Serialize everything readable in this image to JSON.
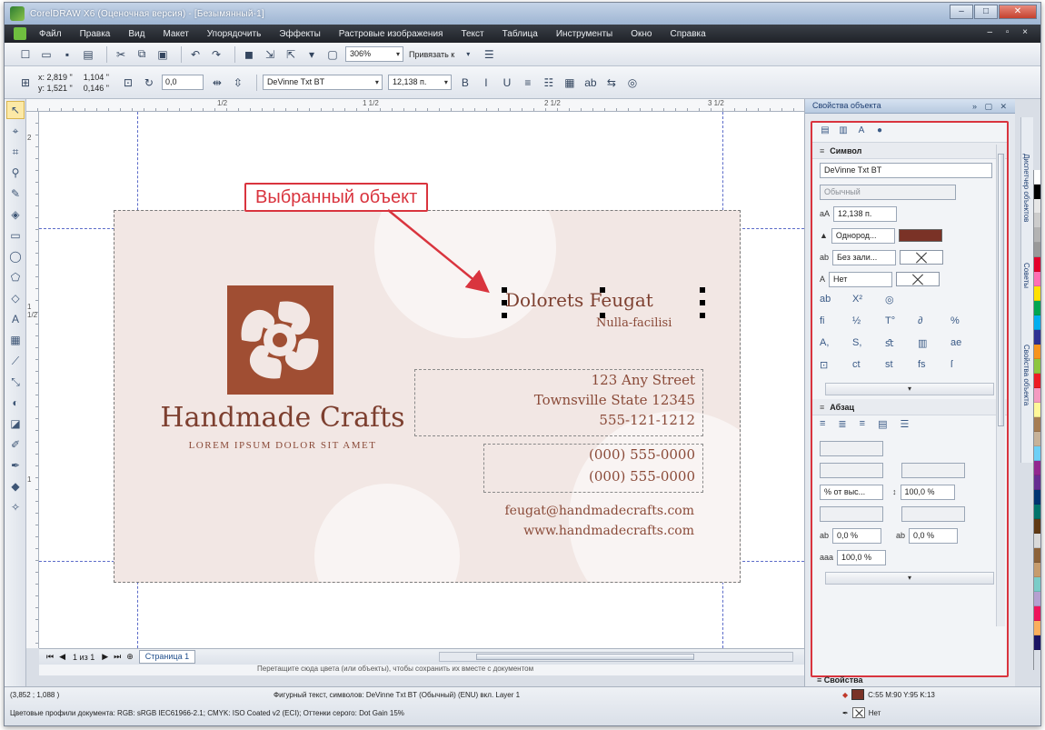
{
  "window": {
    "title": "CorelDRAW X6 (Оценочная версия) - [Безымянный-1]",
    "controls": [
      "–",
      "□",
      "✕"
    ]
  },
  "menu": {
    "items": [
      "Файл",
      "Правка",
      "Вид",
      "Макет",
      "Упорядочить",
      "Эффекты",
      "Растровые изображения",
      "Текст",
      "Таблица",
      "Инструменты",
      "Окно",
      "Справка"
    ],
    "right_controls": "– ▫ ×"
  },
  "toolbar1": {
    "zoom": "306%",
    "snap": "Привязать к"
  },
  "toolbar2": {
    "x": "x: 2,819 \"",
    "y": "y: 1,521 \"",
    "w": "1,104 \"",
    "h": "0,146 \"",
    "angle": "0,0",
    "font": "DeVinne Txt BT",
    "size": "12,138 п."
  },
  "rulers": {
    "h_ticks": [
      "1/2",
      "1 1/2",
      "2 1/2",
      "3 1/2"
    ],
    "v_ticks": [
      "2",
      "1 1/2",
      "1"
    ]
  },
  "card": {
    "company": "Handmade Crafts",
    "tagline": "LOREM IPSUM DOLOR SIT AMET",
    "person": "Dolorets Feugat",
    "person_sub": "Nulla-facilisi",
    "address1": "123 Any Street",
    "address2": "Townsville State 12345",
    "phone1": "555-121-1212",
    "phone2": "(000) 555-0000",
    "phone3": "(000) 555-0000",
    "email": "feugat@handmadecrafts.com",
    "web": "www.handmadecrafts.com",
    "logo_color": "#a04e33"
  },
  "callout": {
    "text": "Выбранный объект",
    "color": "#d9343e"
  },
  "pagebar": {
    "counter": "1 из 1",
    "page_tab": "Страница 1"
  },
  "hint": "Перетащите сюда цвета (или объекты), чтобы сохранить их вместе с документом",
  "dock": {
    "title": "Свойства объекта",
    "section_char": "Символ",
    "font": "DeVinne Txt BT",
    "style": "Обычный",
    "size": "12,138 п.",
    "fill_type": "Однород...",
    "fill_color": "#7a3226",
    "bg_fill": "Без зали...",
    "outline": "Нет",
    "section_para": "Абзац",
    "line_spacing_mode": "% от выс...",
    "line_spacing": "100,0 %",
    "char_spacing": "0,0 %",
    "word_spacing": "0,0 %",
    "lang_spacing": "100,0 %",
    "section_frame": "Свойства",
    "vtabs": [
      "Свойства объекта",
      "Диспетчер объектов",
      "Советы"
    ]
  },
  "palette": [
    "#ffffff",
    "#000000",
    "#e6e6e6",
    "#cccccc",
    "#b3b3b3",
    "#999999",
    "#e4002b",
    "#ff6fb4",
    "#ffe100",
    "#00a651",
    "#00aeef",
    "#2e3192",
    "#f7941d",
    "#8dc63f",
    "#ed1c24",
    "#f49ac1",
    "#fff799",
    "#a67c52",
    "#c7b299",
    "#6dcff6",
    "#92278f",
    "#662d91",
    "#003471",
    "#00746b",
    "#603913",
    "#d9d9d9",
    "#8c6239",
    "#c69c6d",
    "#7accc8",
    "#b5a0d0",
    "#ee145b",
    "#fbaf5d",
    "#1b1464"
  ],
  "status": {
    "coords": "(3,852 ; 1,088 )",
    "object": "Фигурный текст, символов: DeVinne Txt BT (Обычный) (ENU) вкл. Layer 1",
    "profile": "Цветовые профили документа: RGB: sRGB IEC61966-2.1; CMYK: ISO Coated v2 (ECI); Оттенки серого: Dot Gain 15%",
    "fill_spec": "C:55 M:90 Y:95 K:13",
    "outline_spec": "Нет"
  }
}
